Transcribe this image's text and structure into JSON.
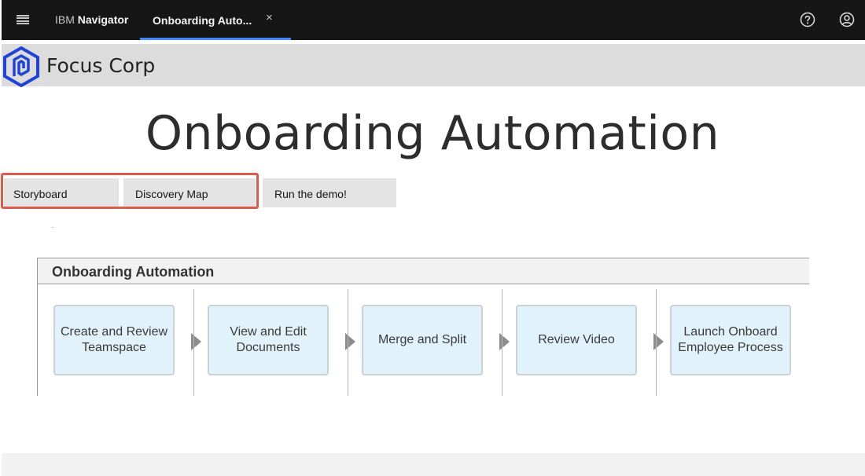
{
  "header": {
    "brand_prefix": "IBM",
    "brand_name": "Navigator",
    "tab_label": "Onboarding Auto...",
    "tab_close": "×",
    "menu_icon": "hamburger-menu-icon",
    "help_icon": "help-icon",
    "user_icon": "user-avatar-icon",
    "accent": "#4589ff"
  },
  "corp": {
    "name": "Focus Corp",
    "logo_color": "#1f43d6"
  },
  "page": {
    "title": "Onboarding Automation"
  },
  "tabs": [
    {
      "label": "Storyboard"
    },
    {
      "label": "Discovery Map"
    },
    {
      "label": "Run the demo!"
    }
  ],
  "highlight_color": "#e0594d",
  "diagram": {
    "title": "Onboarding Automation",
    "steps": [
      {
        "label": "Create and Review Teamspace"
      },
      {
        "label": "View and Edit Documents"
      },
      {
        "label": "Merge and Split"
      },
      {
        "label": "Review Video"
      },
      {
        "label": "Launch Onboard Employee Process"
      }
    ]
  }
}
